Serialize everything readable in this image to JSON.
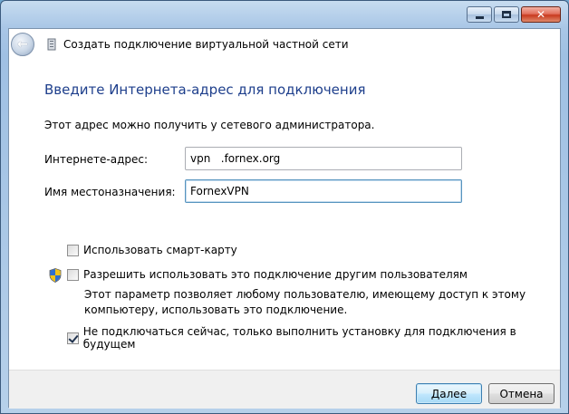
{
  "window": {
    "title": "Создать подключение виртуальной частной сети"
  },
  "page": {
    "heading": "Введите Интернета-адрес для подключения",
    "description": "Этот адрес можно получить у сетевого администратора."
  },
  "form": {
    "address_label": "Интернете-адрес:",
    "address_value": "vpn   .fornex.org",
    "destination_label": "Имя местоназначения:",
    "destination_value": "FornexVPN"
  },
  "options": {
    "smartcard_label": "Использовать смарт-карту",
    "smartcard_checked": false,
    "allow_others_label": "Разрешить использовать это подключение другим пользователям",
    "allow_others_checked": false,
    "allow_others_note_line1": "Этот параметр позволяет любому пользователю, имеющему доступ к этому",
    "allow_others_note_line2": "компьютеру, использовать это подключение.",
    "no_connect_label": "Не подключаться сейчас, только выполнить установку для подключения в будущем",
    "no_connect_checked": true
  },
  "buttons": {
    "next": "Далее",
    "cancel": "Отмена"
  },
  "colors": {
    "heading": "#1e3f8c",
    "accent": "#3c7fb1"
  },
  "icons": {
    "back": "back-arrow-icon",
    "wizard": "network-connection-icon",
    "shield": "uac-shield-icon"
  }
}
